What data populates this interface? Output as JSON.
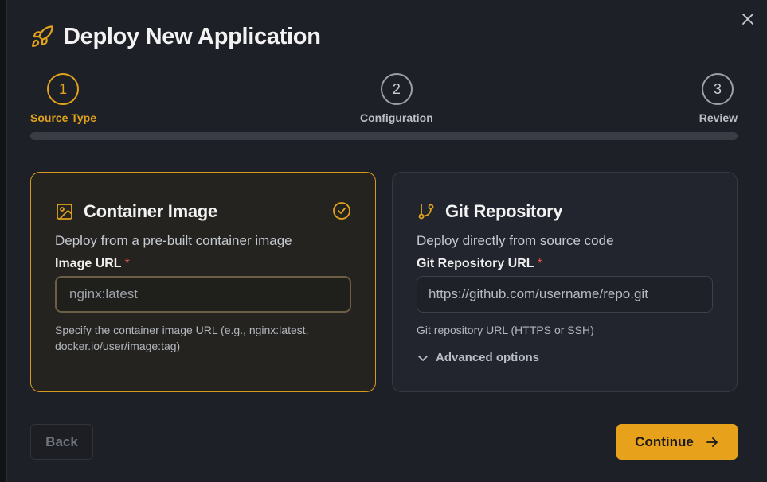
{
  "dialog": {
    "title": "Deploy New Application",
    "title_icon": "rocket-icon",
    "close_icon": "close-icon"
  },
  "stepper": {
    "steps": [
      {
        "number": "1",
        "label": "Source Type",
        "active": true
      },
      {
        "number": "2",
        "label": "Configuration",
        "active": false
      },
      {
        "number": "3",
        "label": "Review",
        "active": false
      }
    ],
    "progress": 0
  },
  "cards": {
    "container": {
      "icon": "image-icon",
      "title": "Container Image",
      "description": "Deploy from a pre-built container image",
      "field_label": "Image URL",
      "required_mark": "*",
      "input_placeholder": "nginx:latest",
      "help_text": "Specify the container image URL (e.g., nginx:latest, docker.io/user/image:tag)",
      "selected": true,
      "selected_icon": "check-circle-icon"
    },
    "git": {
      "icon": "git-branch-icon",
      "title": "Git Repository",
      "description": "Deploy directly from source code",
      "field_label": "Git Repository URL",
      "required_mark": "*",
      "input_placeholder": "https://github.com/username/repo.git",
      "help_text": "Git repository URL (HTTPS or SSH)",
      "advanced_label": "Advanced options",
      "advanced_icon": "chevron-down-icon"
    }
  },
  "footer": {
    "back_label": "Back",
    "continue_label": "Continue",
    "continue_icon": "arrow-right-icon"
  },
  "colors": {
    "accent": "#e8a11a",
    "required": "#e05a4a",
    "background": "#1e2027"
  }
}
